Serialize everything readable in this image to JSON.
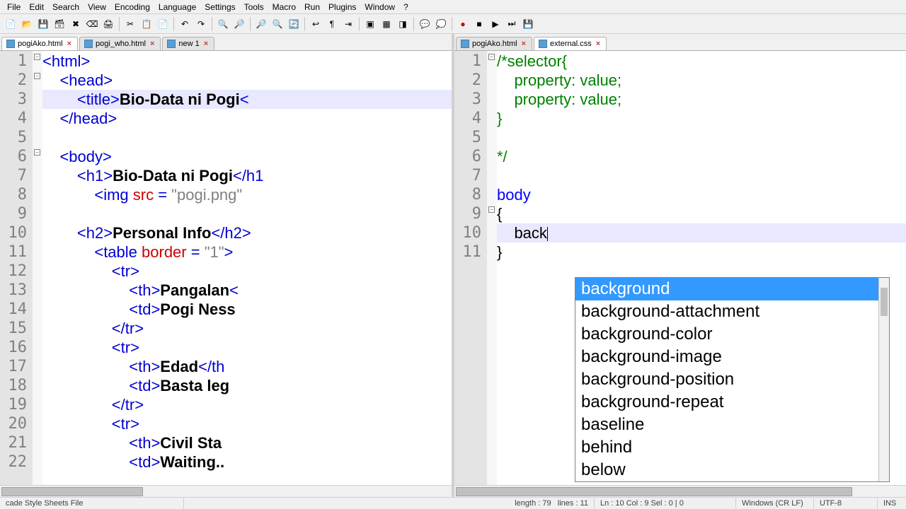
{
  "menu": [
    "File",
    "Edit",
    "Search",
    "View",
    "Encoding",
    "Language",
    "Settings",
    "Tools",
    "Macro",
    "Run",
    "Plugins",
    "Window",
    "?"
  ],
  "toolbar_icons": [
    "new-icon",
    "open-icon",
    "save-icon",
    "saveall-icon",
    "close-icon",
    "closeall-icon",
    "print-icon",
    "sep",
    "cut-icon",
    "copy-icon",
    "paste-icon",
    "sep",
    "undo-icon",
    "redo-icon",
    "sep",
    "find-icon",
    "replace-icon",
    "sep",
    "zoomin-icon",
    "zoomout-icon",
    "sync-icon",
    "sep",
    "wordwrap-icon",
    "allchars-icon",
    "indent-icon",
    "sep",
    "foldall-icon",
    "unfoldall-icon",
    "hidelines-icon",
    "sep",
    "comment-icon",
    "uncomment-icon",
    "sep",
    "record-icon",
    "stop-icon",
    "play-icon",
    "playall-icon",
    "savemacro-icon"
  ],
  "left_tabs": [
    {
      "name": "pogiAko.html",
      "active": true
    },
    {
      "name": "pogi_who.html",
      "active": false
    },
    {
      "name": "new 1",
      "active": false
    }
  ],
  "right_tabs": [
    {
      "name": "pogiAko.html",
      "active": false
    },
    {
      "name": "external.css",
      "active": true
    }
  ],
  "left_lines": 22,
  "right_lines": 11,
  "left_hl": 3,
  "right_hl": 10,
  "left_code": {
    "l1": {
      "a": "<html>"
    },
    "l2": {
      "a": "    <head>"
    },
    "l3": {
      "a": "        <title>",
      "b": "Bio-Data ni Pogi",
      "c": "<"
    },
    "l4": {
      "a": "    </head>"
    },
    "l5": {
      "a": ""
    },
    "l6": {
      "a": "    <body>"
    },
    "l7": {
      "a": "        <h1>",
      "b": "Bio-Data ni Pogi",
      "c": "</h1"
    },
    "l8": {
      "a": "            <img ",
      "attr": "src",
      "eq": " = ",
      "str": "\"pogi.png\""
    },
    "l9": {
      "a": ""
    },
    "l10": {
      "a": "        <h2>",
      "b": "Personal Info",
      "c": "</h2>"
    },
    "l11": {
      "a": "            <table ",
      "attr": "border",
      "eq": " = ",
      "str": "\"1\"",
      "c": ">"
    },
    "l12": {
      "a": "                <tr>"
    },
    "l13": {
      "a": "                    <th>",
      "b": "Pangalan",
      "c": "<"
    },
    "l14": {
      "a": "                    <td>",
      "b": "Pogi Ness"
    },
    "l15": {
      "a": "                </tr>"
    },
    "l16": {
      "a": "                <tr>"
    },
    "l17": {
      "a": "                    <th>",
      "b": "Edad",
      "c": "</th"
    },
    "l18": {
      "a": "                    <td>",
      "b": "Basta leg"
    },
    "l19": {
      "a": "                </tr>"
    },
    "l20": {
      "a": "                <tr>"
    },
    "l21": {
      "a": "                    <th>",
      "b": "Civil Sta"
    },
    "l22": {
      "a": "                    <td>",
      "b": "Waiting.."
    }
  },
  "right_code": {
    "l1": "/*selector{",
    "l2": "    property: value;",
    "l3": "    property: value;",
    "l4": "}",
    "l5": "",
    "l6": "*/",
    "l7": "",
    "l8": "body",
    "l9": "{",
    "l10": "    back",
    "l11": "}"
  },
  "autocomplete": [
    "background",
    "background-attachment",
    "background-color",
    "background-image",
    "background-position",
    "background-repeat",
    "baseline",
    "behind",
    "below"
  ],
  "status": {
    "type": "cade Style Sheets File",
    "length": "length : 79",
    "lines": "lines : 11",
    "pos": "Ln : 10   Col : 9   Sel : 0 | 0",
    "eol": "Windows (CR LF)",
    "enc": "UTF-8",
    "ins": "INS"
  }
}
